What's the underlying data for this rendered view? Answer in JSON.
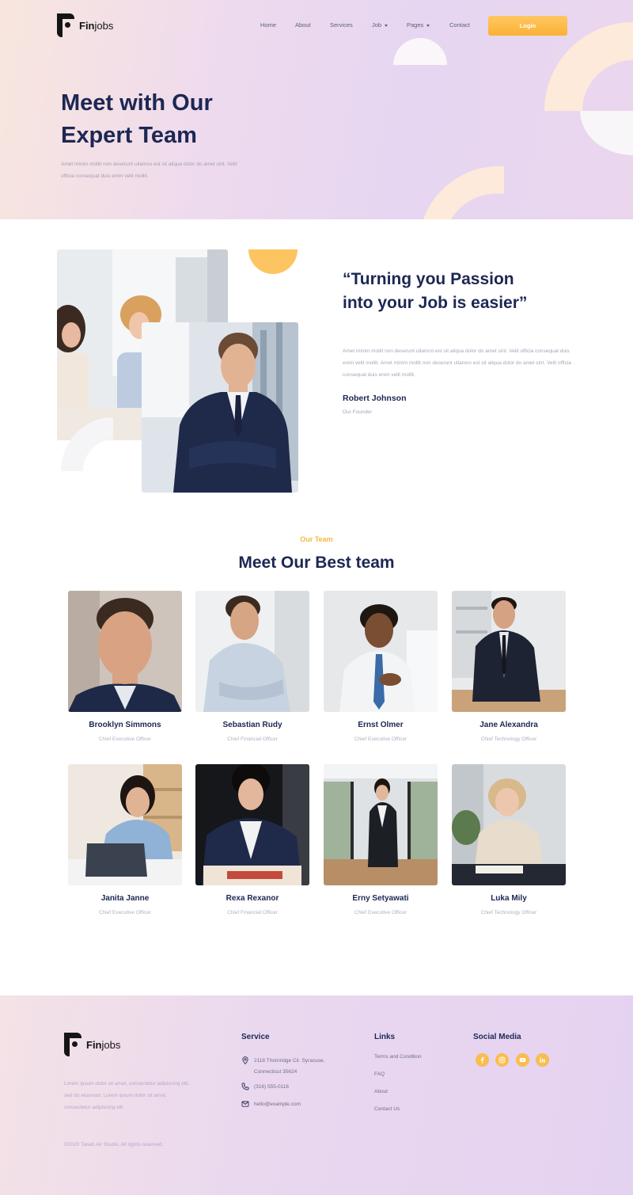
{
  "brand": {
    "name_bold": "Fin",
    "name_rest": "jobs"
  },
  "nav": {
    "items": [
      {
        "label": "Home",
        "has_caret": false
      },
      {
        "label": "About",
        "has_caret": false
      },
      {
        "label": "Services",
        "has_caret": false
      },
      {
        "label": "Job",
        "has_caret": true
      },
      {
        "label": "Pages",
        "has_caret": true
      },
      {
        "label": "Contact",
        "has_caret": false
      }
    ],
    "login_label": "Login"
  },
  "hero": {
    "title_line1": "Meet with Our",
    "title_line2": "Expert Team",
    "description": "Amet minim mollit non deserunt ullamco est sit aliqua dolor do amet sint. Velit officia consequat duis enim velit mollit."
  },
  "about": {
    "quote": "“Turning you Passion into your Job is easier”",
    "description": "Amet minim mollit non deserunt ullamco est sit aliqua dolor do amet sint. Velit officia consequat duis enim velit mollit. Amet minim mollit non deserunt ullamco est sit aliqua dolor do amet sint. Velit officia consequat duis enim velit mollit.",
    "founder_name": "Robert Johnson",
    "founder_role": "Our Founder"
  },
  "team": {
    "eyebrow": "Our Team",
    "title": "Meet Our Best team",
    "members": [
      {
        "name": "Brooklyn Simmons",
        "role": "Chief Executive Officer"
      },
      {
        "name": "Sebastian Rudy",
        "role": "Chief Financial Officer"
      },
      {
        "name": "Ernst Olmer",
        "role": "Chief Executive Officer"
      },
      {
        "name": "Jane Alexandra",
        "role": "Chief Technology Officer"
      },
      {
        "name": "Janita Janne",
        "role": "Chief Executive Officer"
      },
      {
        "name": "Rexa Rexanor",
        "role": "Chief Financial Officer"
      },
      {
        "name": "Erny Setyawati",
        "role": "Chief Executive Officer"
      },
      {
        "name": "Luka Mily",
        "role": "Chief Technology Officer"
      }
    ]
  },
  "footer": {
    "description": "Lorem ipsum dolor sit amet, consectetur adipiscing elit, sed do eiusmod. Lorem ipsum dolor sit amet, consectetur adipiscing elit",
    "copyright": "©2020 Tanah Air Studio. All rights reserved.",
    "service": {
      "heading": "Service",
      "address": "2118 Thornridge Cir. Syracuse, Connecticut 35624",
      "phone": "(316) 555-0116",
      "email": "hello@example.com"
    },
    "links": {
      "heading": "Links",
      "items": [
        "Terms and Condition",
        "FAQ",
        "About",
        "Contact Us"
      ]
    },
    "social": {
      "heading": "Social Media",
      "icons": [
        "facebook-icon",
        "instagram-icon",
        "youtube-icon",
        "linkedin-icon"
      ]
    }
  },
  "colors": {
    "accent": "#f9b233",
    "navy": "#1c2753",
    "muted": "#a6a6ba"
  }
}
